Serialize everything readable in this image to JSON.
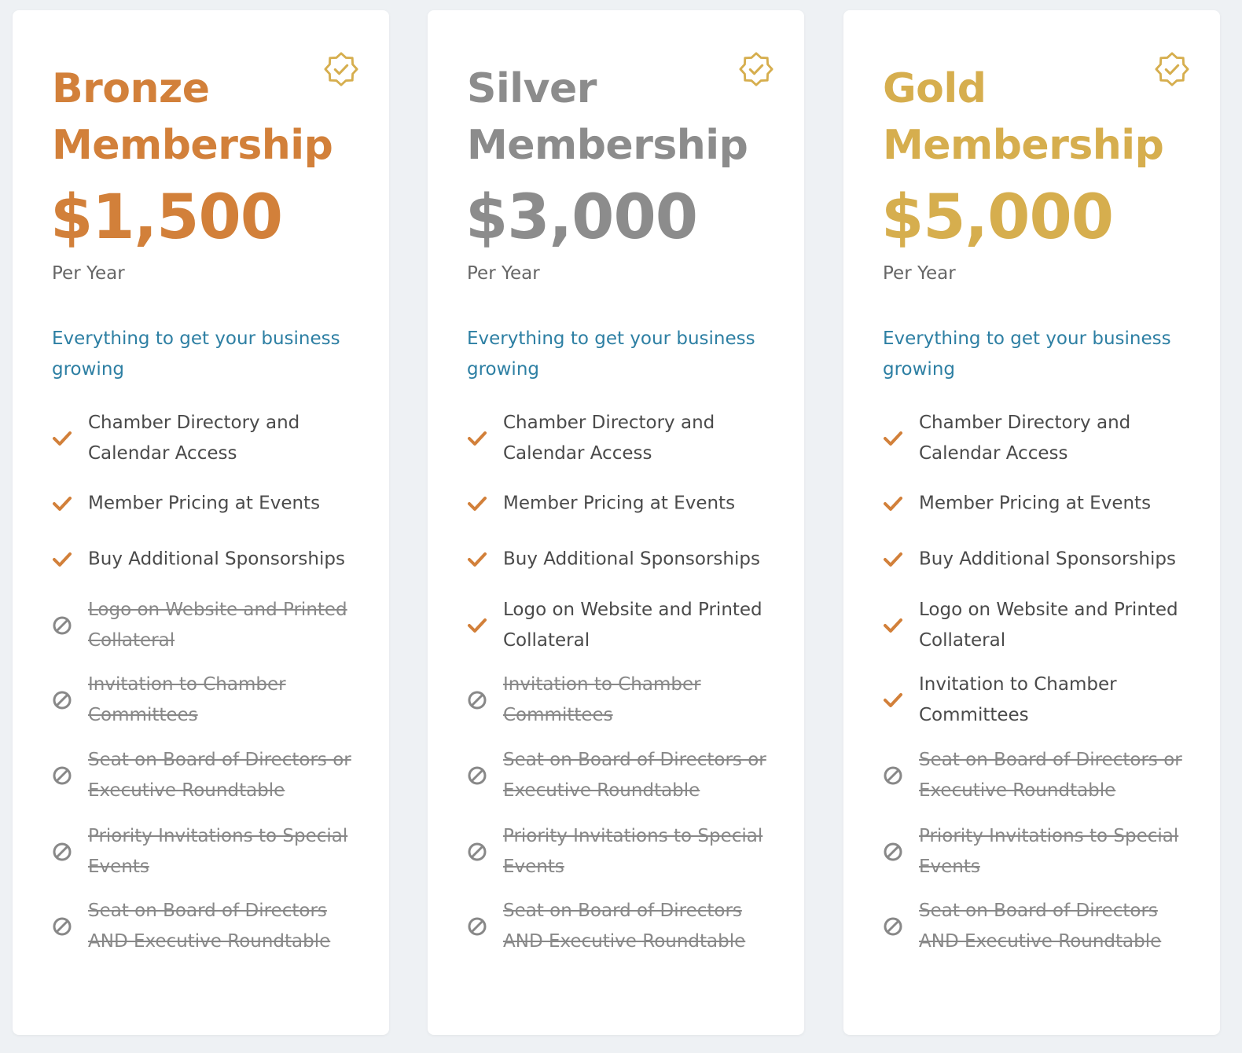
{
  "colors": {
    "bronze": "#d2803a",
    "silver": "#8c8c8c",
    "gold": "#d6ae4e",
    "tagline": "#2d7fa3",
    "check": "#d2803a",
    "disabled": "#888888"
  },
  "plans": [
    {
      "title_line1": "Bronze",
      "title_line2": "Membership",
      "price": "$1,500",
      "period": "Per Year",
      "tagline": "Everything to get your business growing",
      "color": "bronze",
      "badge_icon": "verified-badge-icon",
      "features": [
        {
          "text": "Chamber Directory and Calendar Access",
          "included": true
        },
        {
          "text": "Member Pricing at Events",
          "included": true
        },
        {
          "text": "Buy Additional Sponsorships",
          "included": true
        },
        {
          "text": "Logo on Website and Printed Collateral",
          "included": false
        },
        {
          "text": "Invitation to Chamber Committees",
          "included": false
        },
        {
          "text": "Seat on Board of Directors or Executive Roundtable",
          "included": false
        },
        {
          "text": "Priority Invitations to Special Events",
          "included": false
        },
        {
          "text": "Seat on Board of Directors AND Executive Roundtable",
          "included": false
        }
      ]
    },
    {
      "title_line1": "Silver",
      "title_line2": "Membership",
      "price": "$3,000",
      "period": "Per Year",
      "tagline": "Everything to get your business growing",
      "color": "silver",
      "badge_icon": "verified-badge-icon",
      "features": [
        {
          "text": "Chamber Directory and Calendar Access",
          "included": true
        },
        {
          "text": "Member Pricing at Events",
          "included": true
        },
        {
          "text": "Buy Additional Sponsorships",
          "included": true
        },
        {
          "text": "Logo on Website and Printed Collateral",
          "included": true
        },
        {
          "text": "Invitation to Chamber Committees",
          "included": false
        },
        {
          "text": "Seat on Board of Directors or Executive Roundtable",
          "included": false
        },
        {
          "text": "Priority Invitations to Special Events",
          "included": false
        },
        {
          "text": "Seat on Board of Directors AND Executive Roundtable",
          "included": false
        }
      ]
    },
    {
      "title_line1": "Gold",
      "title_line2": "Membership",
      "price": "$5,000",
      "period": "Per Year",
      "tagline": "Everything to get your business growing",
      "color": "gold",
      "badge_icon": "verified-badge-icon",
      "features": [
        {
          "text": "Chamber Directory and Calendar Access",
          "included": true
        },
        {
          "text": "Member Pricing at Events",
          "included": true
        },
        {
          "text": "Buy Additional Sponsorships",
          "included": true
        },
        {
          "text": "Logo on Website and Printed Collateral",
          "included": true
        },
        {
          "text": "Invitation to Chamber Committees",
          "included": true
        },
        {
          "text": "Seat on Board of Directors or Executive Roundtable",
          "included": false
        },
        {
          "text": "Priority Invitations to Special Events",
          "included": false
        },
        {
          "text": "Seat on Board of Directors AND Executive Roundtable",
          "included": false
        }
      ]
    }
  ]
}
